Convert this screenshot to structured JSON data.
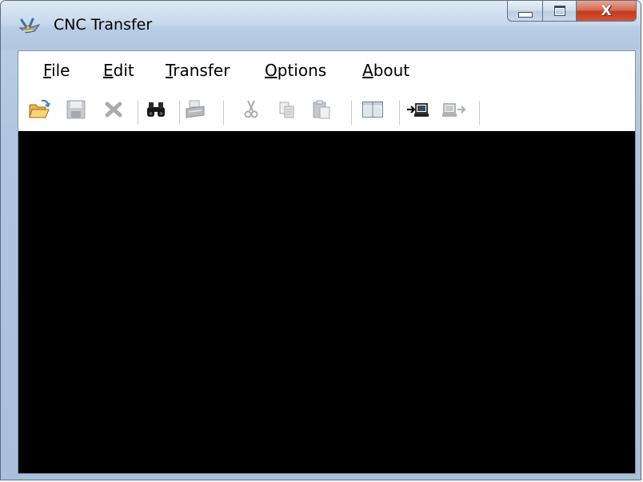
{
  "window": {
    "title": "CNC Transfer"
  },
  "title_icon": "cnc-mill-icon",
  "caption": {
    "minimize_icon": "minimize-icon",
    "maximize_icon": "maximize-icon",
    "close_icon": "close-icon",
    "close_glyph": "X"
  },
  "menu": {
    "items": [
      {
        "mnemonic": "F",
        "rest": "ile"
      },
      {
        "mnemonic": "E",
        "rest": "dit"
      },
      {
        "mnemonic": "T",
        "rest": "ransfer"
      },
      {
        "mnemonic": "O",
        "rest": "ptions"
      },
      {
        "mnemonic": "A",
        "rest": "bout"
      }
    ]
  },
  "toolbar": {
    "buttons": [
      {
        "icon": "open-folder-icon",
        "enabled": true
      },
      {
        "icon": "save-icon",
        "enabled": false
      },
      {
        "icon": "delete-icon",
        "enabled": false
      },
      {
        "icon": "find-binoculars-icon",
        "enabled": true
      },
      {
        "icon": "print-icon",
        "enabled": false
      },
      {
        "icon": "cut-icon",
        "enabled": false
      },
      {
        "icon": "copy-icon",
        "enabled": false
      },
      {
        "icon": "paste-icon",
        "enabled": false
      },
      {
        "icon": "split-view-icon",
        "enabled": true
      },
      {
        "icon": "receive-icon",
        "enabled": true
      },
      {
        "icon": "send-icon",
        "enabled": false
      }
    ]
  },
  "colors": {
    "canvas_background": "#000000",
    "title_bar": "#b9cde3",
    "close_button": "#c4391a"
  }
}
